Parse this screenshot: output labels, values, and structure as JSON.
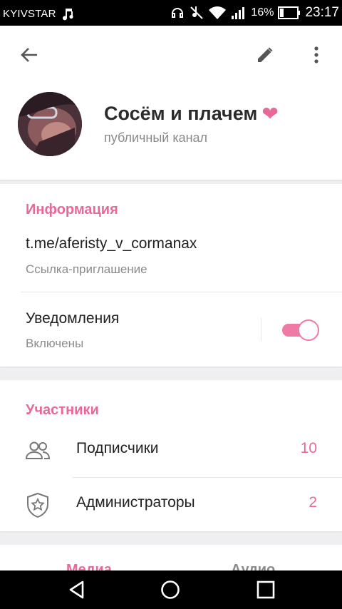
{
  "status_bar": {
    "carrier": "KYIVSTAR",
    "battery": "16%",
    "time": "23:17"
  },
  "channel": {
    "title": "Сосём и плачем",
    "title_emoji": "❤",
    "subtitle": "публичный канал"
  },
  "info": {
    "section_title": "Информация",
    "link": "t.me/aferisty_v_cormanax",
    "link_caption": "Ссылка-приглашение",
    "notifications_label": "Уведомления",
    "notifications_status": "Включены",
    "notifications_enabled": true
  },
  "members": {
    "section_title": "Участники",
    "rows": [
      {
        "label": "Подписчики",
        "count": "10",
        "icon": "people-icon"
      },
      {
        "label": "Администраторы",
        "count": "2",
        "icon": "shield-star-icon"
      }
    ]
  },
  "tabs": [
    {
      "label": "Медиа",
      "active": true
    },
    {
      "label": "Аудио",
      "active": false
    }
  ],
  "colors": {
    "accent": "#e8689a",
    "background": "#efeff1"
  }
}
